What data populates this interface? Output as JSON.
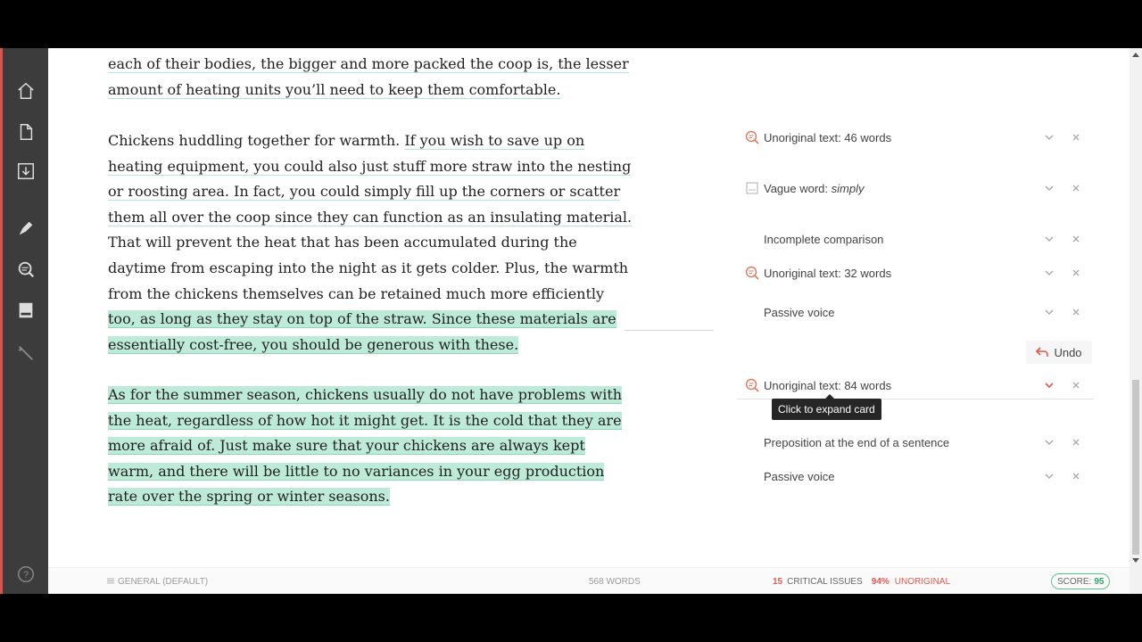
{
  "sidebar": {
    "items": [
      {
        "name": "home-icon"
      },
      {
        "name": "document-icon"
      },
      {
        "name": "download-icon"
      },
      {
        "name": "pen-icon"
      },
      {
        "name": "search-report-icon"
      },
      {
        "name": "book-icon"
      },
      {
        "name": "wand-icon"
      }
    ],
    "help": "?"
  },
  "editor": {
    "p1_partial": "each of their bodies, the bigger and more packed the coop is, the lesser amount of heating units you’ll need to keep them comfortable.",
    "p2_a": "Chickens huddling together for warmth. ",
    "p2_b": "If you wish to save up on heating equipment, you could also just stuff more straw into the nesting or roosting area. In fact, you could simply fill up the corners or scatter them all over the coop since they can function as an insulating material.",
    "p2_c": " That will prevent the heat that has been accumulated during the daytime from escaping into the night as it gets colder. Plus, the warmth from the chickens themselves can be retained much more efficiently ",
    "p2_d": "too, as long as they stay on top of the straw. Since these materials are essentially cost-free, you should be generous with these.",
    "p3": "As for the summer season, chickens usually do not have problems with the heat, regardless of how hot it might get. It is the cold that they are more afraid of. Just make sure that your chickens are always kept warm, and there will be little to no variances in your egg production rate over the spring or winter seasons."
  },
  "cards": [
    {
      "title": "Unoriginal text: 46 words",
      "icon": "unoriginal-icon"
    },
    {
      "title_prefix": "Vague word: ",
      "title_em": "simply",
      "icon": "vague-word-icon"
    },
    {
      "title": "Incomplete comparison",
      "icon": ""
    },
    {
      "title": "Unoriginal text: 32 words",
      "icon": "unoriginal-icon"
    },
    {
      "title": "Passive voice",
      "icon": ""
    },
    {
      "title": "Unoriginal text: 84 words",
      "icon": "unoriginal-icon",
      "active": true
    },
    {
      "title": "Preposition at the end of a sentence",
      "icon": ""
    },
    {
      "title": "Passive voice",
      "icon": ""
    }
  ],
  "undo": {
    "label": "Undo"
  },
  "tooltip": {
    "text": "Click to expand card"
  },
  "footer": {
    "mode": "GENERAL (DEFAULT)",
    "words": "568 WORDS",
    "critical_count": "15",
    "critical_label": "CRITICAL ISSUES",
    "unoriginal_pct": "94%",
    "unoriginal_label": "UNORIGINAL",
    "score_label": "SCORE:",
    "score_value": "95"
  },
  "colors": {
    "sidebar": "#3c3c3c",
    "accent_red": "#e05a4f",
    "highlight_green": "#bdebd8",
    "score_green": "#2fa36b"
  }
}
